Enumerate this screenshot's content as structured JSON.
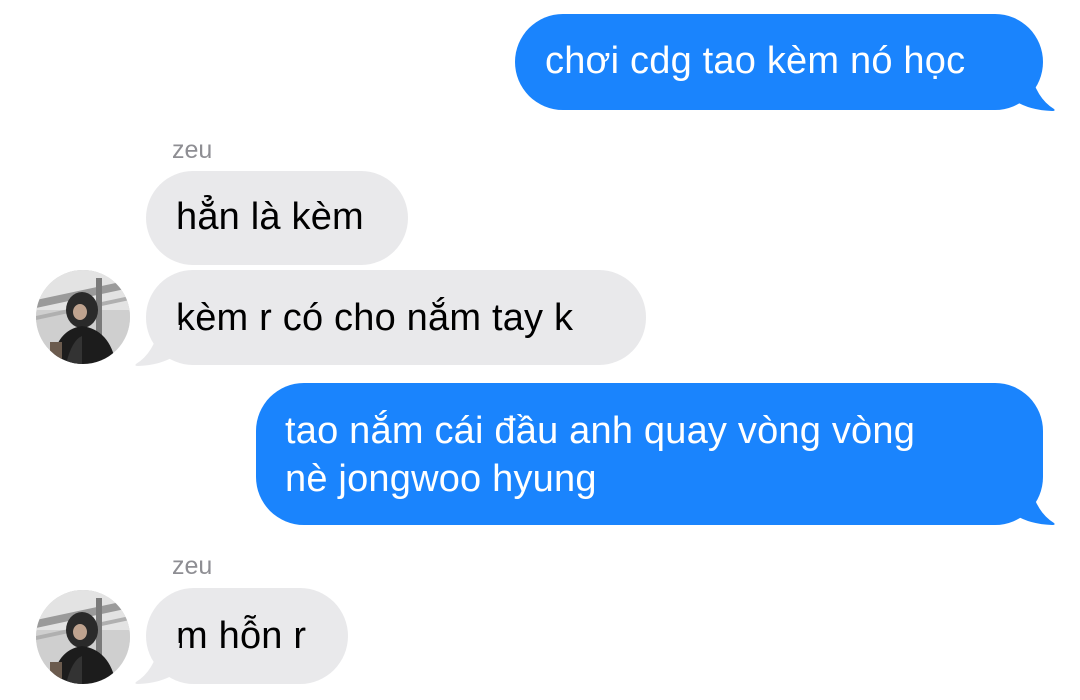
{
  "conversation": {
    "messages": [
      {
        "direction": "outgoing",
        "text": "chơi cdg tao kèm nó học"
      },
      {
        "direction": "incoming",
        "sender": "zeu",
        "text": "hẳn là kèm"
      },
      {
        "direction": "incoming",
        "text": "kèm r có cho nắm tay k"
      },
      {
        "direction": "outgoing",
        "lines": [
          "tao nắm cái đầu anh quay vòng vòng",
          "nè jongwoo hyung"
        ]
      },
      {
        "direction": "incoming",
        "sender": "zeu",
        "text": "m hỗn r"
      }
    ]
  },
  "colors": {
    "outgoing_bubble": "#1a84fd",
    "incoming_bubble": "#e9e9eb",
    "sender_name": "#8e8e93"
  },
  "icons": {
    "avatar": "contact-avatar-photo"
  }
}
